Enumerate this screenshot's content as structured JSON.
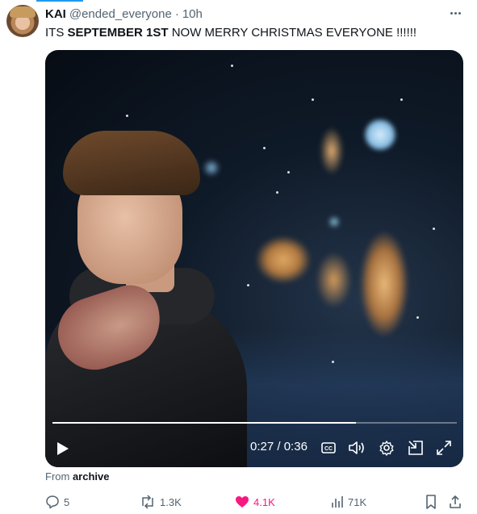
{
  "tweet": {
    "author_name": "KAI",
    "author_handle": "@ended_everyone",
    "separator": "·",
    "timestamp": "10h",
    "text_prefix": "ITS ",
    "text_bold": "SEPTEMBER 1ST",
    "text_suffix": " NOW MERRY CHRISTMAS EVERYONE !!!!!!"
  },
  "video": {
    "current_time": "0:27",
    "duration": "0:36",
    "time_separator": " / ",
    "progress_fraction": 0.75,
    "cc_label": "CC"
  },
  "source": {
    "prefix": "From ",
    "name": "archive"
  },
  "actions": {
    "replies": "5",
    "reposts": "1.3K",
    "likes": "4.1K",
    "views": "71K"
  },
  "colors": {
    "accent": "#1d9bf0",
    "like": "#f91880",
    "secondary_text": "#536471",
    "primary_text": "#0f1419"
  },
  "icons": [
    "more-icon",
    "play-icon",
    "cc-icon",
    "volume-icon",
    "settings-icon",
    "pip-icon",
    "fullscreen-icon",
    "reply-icon",
    "repost-icon",
    "like-icon",
    "views-icon",
    "bookmark-icon",
    "share-icon"
  ]
}
